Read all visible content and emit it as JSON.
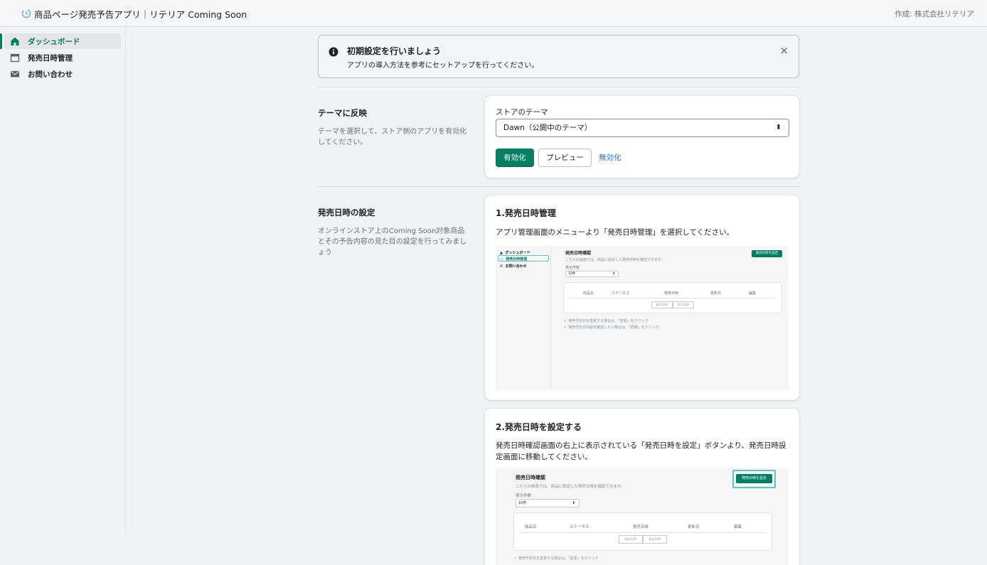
{
  "topbar": {
    "app_title": "商品ページ発売予告アプリ｜リテリア Coming Soon",
    "credit": "作成: 株式会社リテリア"
  },
  "sidebar": {
    "items": [
      {
        "label": "ダッシュボード",
        "icon": "home-icon",
        "active": true
      },
      {
        "label": "発売日時管理",
        "icon": "calendar-icon",
        "active": false
      },
      {
        "label": "お問い合わせ",
        "icon": "mail-icon",
        "active": false
      }
    ]
  },
  "banner": {
    "title": "初期設定を行いましょう",
    "subtitle": "アプリの導入方法を参考にセットアップを行ってください。",
    "close": "×"
  },
  "theme_section": {
    "title": "テーマに反映",
    "description": "テーマを選択して、ストア側のアプリを有効化してください。",
    "select_label": "ストアのテーマ",
    "select_value": "Dawn（公開中のテーマ）",
    "select_arrows": "⬍",
    "enable_button": "有効化",
    "preview_button": "プレビュー",
    "disable_button": "無効化"
  },
  "release_section": {
    "title": "発売日時の設定",
    "description": "オンラインストア上のComing Soon対象商品とその予告内容の見た目の設定を行ってみましょう"
  },
  "step1": {
    "heading": "1.発売日時管理",
    "text": "アプリ管理画面のメニューより「発売日時管理」を選択してください。",
    "mock": {
      "nav": [
        "ダッシュボード",
        "発売日時管理",
        "お問い合わせ"
      ],
      "title": "発売日時確認",
      "subtitle": "こちらの画面では、商品に設定した発売日時を確認できます。",
      "count_label": "表示件数",
      "count_value": "10件",
      "set_button": "発売日時を設定",
      "columns": [
        "商品名",
        "ステータス",
        "発売日時",
        "更新日",
        "編集"
      ],
      "pagination": [
        "前の10件",
        "次の10件"
      ],
      "notes": [
        "発売予定日を変更する場合は、「変更」をクリック",
        "発売予告の内容を確認したい場合は、「詳細」をクリック"
      ]
    }
  },
  "step2": {
    "heading": "2.発売日時を設定する",
    "text": "発売日時確認画面の右上に表示されている「発売日時を設定」ボタンより、発売日時設定画面に移動してください。",
    "mock": {
      "title": "発売日時確認",
      "subtitle": "こちらの画面では、商品に設定した発売日時を確認できます。",
      "count_label": "表示件数",
      "count_value": "10件",
      "set_button": "発売日時を設定",
      "columns": [
        "商品名",
        "ステータス",
        "発売日時",
        "更新日",
        "編集"
      ],
      "pagination": [
        "前の10件",
        "次の10件"
      ],
      "notes": [
        "発売予定日を変更する場合は、「変更」をクリック"
      ]
    }
  },
  "colors": {
    "primary": "#008060",
    "link": "#2c6ecb",
    "highlight": "#5bc0de"
  }
}
